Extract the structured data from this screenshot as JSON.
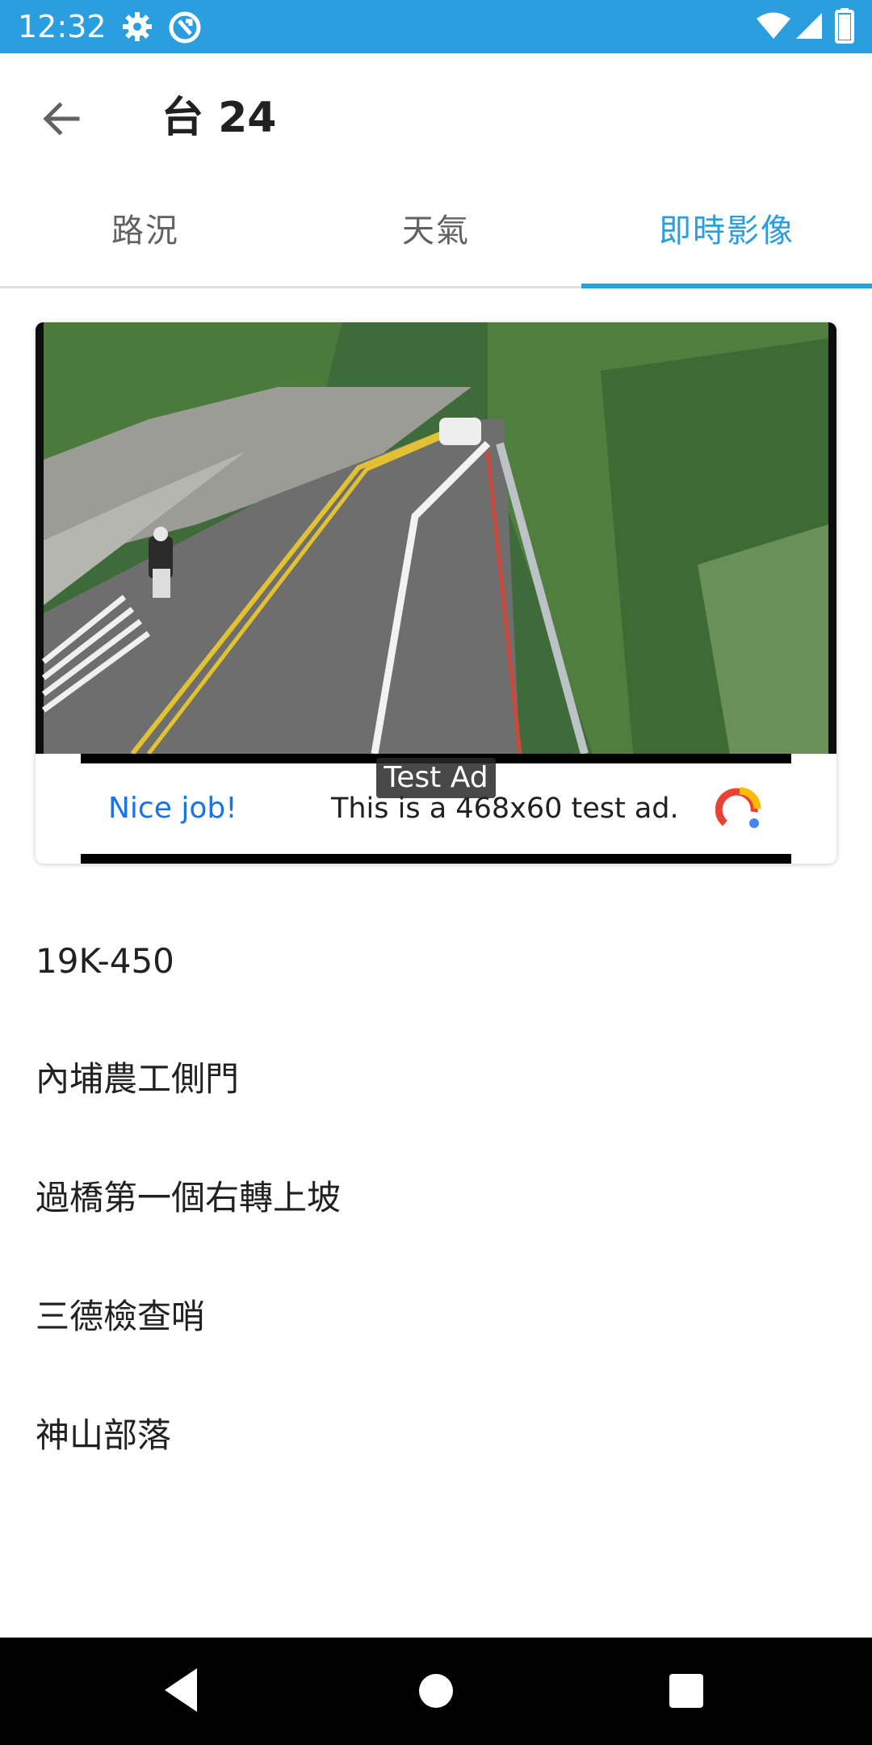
{
  "status_bar": {
    "time": "12:32",
    "icons": [
      "settings-icon",
      "sync-icon",
      "wifi-icon",
      "signal-icon",
      "battery-icon"
    ]
  },
  "app_bar": {
    "title": "台 24",
    "back_icon": "arrow-back-icon"
  },
  "tabs": [
    {
      "label": "路況",
      "active": false
    },
    {
      "label": "天氣",
      "active": false
    },
    {
      "label": "即時影像",
      "active": true
    }
  ],
  "ad": {
    "badge": "Test Ad",
    "left_text": "Nice job!",
    "text": "This is a 468x60 test ad."
  },
  "camera_list": [
    {
      "label": "19K-450"
    },
    {
      "label": "內埔農工側門"
    },
    {
      "label": "過橋第一個右轉上坡"
    },
    {
      "label": "三德檢查哨"
    },
    {
      "label": "神山部落"
    }
  ],
  "nav_bar": {
    "icons": [
      "back-triangle-icon",
      "home-circle-icon",
      "recents-square-icon"
    ]
  },
  "colors": {
    "primary": "#2b9ee0",
    "text_dark": "#212121",
    "tab_inactive": "#616161"
  }
}
